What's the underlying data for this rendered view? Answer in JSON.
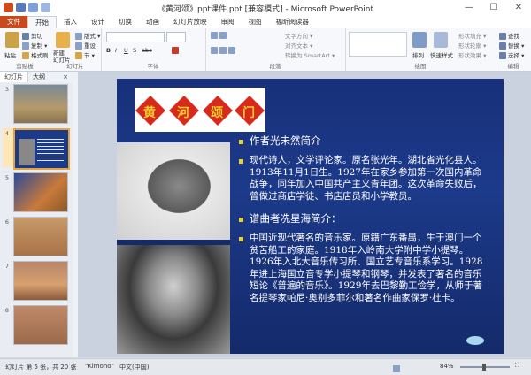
{
  "window": {
    "title": "《黄河颂》ppt课件.ppt [兼容模式] - Microsoft PowerPoint"
  },
  "tabs": [
    "文件",
    "开始",
    "插入",
    "设计",
    "切换",
    "动画",
    "幻灯片放映",
    "审阅",
    "视图",
    "福昕阅读器"
  ],
  "ribbon": {
    "clipboard": {
      "paste": "粘贴",
      "cut": "剪切",
      "copy": "复制 ▾",
      "format_painter": "格式刷",
      "label": "剪贴板"
    },
    "slides": {
      "new_slide": "新建\n幻灯片",
      "layout": "版式 ▾",
      "reset": "重设",
      "section": "节 ▾",
      "label": "幻灯片"
    },
    "font": {
      "label": "字体",
      "bold": "B",
      "italic": "I",
      "underline": "U",
      "strike": "S",
      "abc": "abc"
    },
    "paragraph": {
      "label": "段落",
      "text_direction": "文字方向 ▾",
      "align_text": "对齐文本 ▾",
      "smartart": "转换为 SmartArt ▾"
    },
    "drawing": {
      "label": "绘图",
      "arrange": "排列",
      "quick_styles": "快速样式",
      "shape_fill": "形状填充 ▾",
      "shape_outline": "形状轮廓 ▾",
      "shape_effects": "形状效果 ▾"
    },
    "editing": {
      "label": "编辑",
      "find": "查找",
      "replace": "替换 ▾",
      "select": "选择 ▾"
    }
  },
  "pane": {
    "tab_slides": "幻灯片",
    "tab_outline": "大纲",
    "close": "×"
  },
  "thumbnails": [
    "3",
    "4",
    "5",
    "6",
    "7",
    "8"
  ],
  "slide": {
    "title_chars": [
      "黄",
      "河",
      "颂",
      "门"
    ],
    "bullets": [
      {
        "text": "作者光未然简介"
      },
      {
        "text": "现代诗人，文学评论家。原名张光年。湖北省光化县人。1913年11月1日生。1927年在家乡参加第一次国内革命战争，同年加入中国共产主义青年团。这次革命失败后，曾做过商店学徒、书店店员和小学教员。"
      },
      {
        "text": "谱曲者冼星海简介："
      },
      {
        "text": "中国近现代著名的音乐家。原籍广东番禺，生于澳门一个贫苦船工的家庭。1918年入岭南大学附中学小提琴。1926年入北大音乐传习所、国立艺专音乐系学习。1928年进上海国立音专学小提琴和钢琴，并发表了著名的音乐短论《普遍的音乐》。1929年去巴黎勤工俭学，从师于著名提琴家帕尼·奥别多菲尔和著名作曲家保罗·杜卡。"
      }
    ]
  },
  "status": {
    "slide_info": "幻灯片 第 5 张，共 20 张",
    "theme": "\"Kimono\"",
    "language": "中文(中国)",
    "zoom": "84%"
  },
  "colors": {
    "file_tab": "#c84a1c",
    "slide_bg": "#1c3a8a",
    "bullet": "#e8d23a",
    "selection": "#e8a33a"
  }
}
